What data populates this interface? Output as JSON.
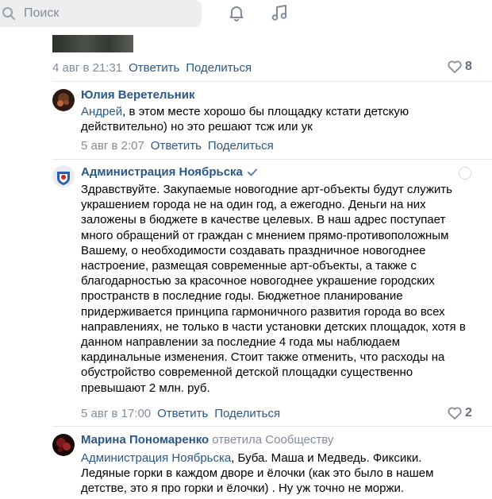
{
  "search": {
    "placeholder": "Поиск"
  },
  "comments": [
    {
      "date": "4 авг в 21:31",
      "reply_label": "Ответить",
      "share_label": "Поделиться",
      "likes": "8"
    },
    {
      "author": "Юлия Веретельник",
      "mention": "Андрей",
      "text_line1": ", в этом месте хорошо бы площадку кстати детскую",
      "text_line2": "действительно) но это решают тсж или ук",
      "date": "5 авг в 2:07",
      "reply_label": "Ответить",
      "share_label": "Поделиться"
    },
    {
      "author": "Администрация Ноябрьска",
      "verified": true,
      "lines": [
        "Здравствуйте. Закупаемые новогодние арт-объекты будут служить",
        "украшением города не на один год, а ежегодно. Деньги на них",
        "заложены в бюджете в качестве целевых. В наш адрес поступает",
        "много обращений от граждан с мнением прямо-противоположным",
        "Вашему, о необходимости создавать праздничное новогоднее",
        "настроение, размещая современные арт-объекты, а также с",
        "благодарностью за красочное новогоднее украшение городских",
        "пространств в последние годы. Бюджетное планирование",
        "придерживается принципа гармоничного развития города во всех",
        "направлениях, не только в части установки детских площадок, хотя в",
        "данном направлении за последние 4 года мы наблюдаем",
        "кардинальные изменения. Стоит также отменить, что расходы на",
        "обустройство современной детской площадки существенно",
        "превышают 2 млн. руб."
      ],
      "date": "5 авг в 17:00",
      "reply_label": "Ответить",
      "share_label": "Поделиться",
      "likes": "2"
    },
    {
      "author": "Марина Пономаренко",
      "replied_to": "ответила Сообществу",
      "mention": "Администрация Ноябрьска",
      "text_line1": ", Буба. Маша и Медведь. Фиксики.",
      "text_line2": "Ледяные горки в каждом дворе и ёлочки (как это было в нашем",
      "text_line3": "детстве, это я про горки и ёлочки) . Ну уж точно не моржи."
    }
  ],
  "colors": {
    "link": "#2a5885",
    "meta": "#818c99",
    "divider": "#e7e8ec",
    "verified": "#5181b8"
  }
}
